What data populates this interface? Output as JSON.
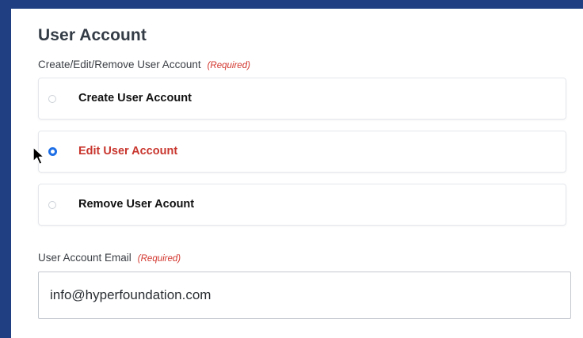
{
  "section": {
    "title": "User Account"
  },
  "action_field": {
    "label": "Create/Edit/Remove User Account",
    "required_text": "(Required)",
    "options": [
      {
        "label": "Create User Account",
        "selected": false
      },
      {
        "label": "Edit User Account",
        "selected": true
      },
      {
        "label": "Remove User Acount",
        "selected": false
      }
    ]
  },
  "email_field": {
    "label": "User Account Email",
    "required_text": "(Required)",
    "value": "info@hyperfoundation.com"
  },
  "colors": {
    "frame": "#1f3f82",
    "selected_text": "#c8352d",
    "radio_checked": "#1e6fe6",
    "required_text": "#d2342c"
  }
}
